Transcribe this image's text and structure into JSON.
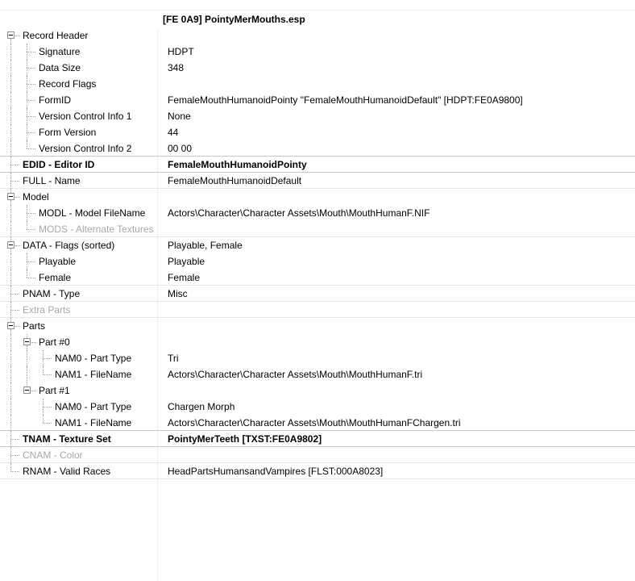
{
  "header": {
    "title": "[FE 0A9] PointyMerMouths.esp"
  },
  "rows": [
    {
      "label": "Record Header",
      "value": ""
    },
    {
      "label": "Signature",
      "value": "HDPT"
    },
    {
      "label": "Data Size",
      "value": "348"
    },
    {
      "label": "Record Flags",
      "value": ""
    },
    {
      "label": "FormID",
      "value": "FemaleMouthHumanoidPointy \"FemaleMouthHumanoidDefault\" [HDPT:FE0A9800]"
    },
    {
      "label": "Version Control Info 1",
      "value": "None"
    },
    {
      "label": "Form Version",
      "value": "44"
    },
    {
      "label": "Version Control Info 2",
      "value": "00 00"
    },
    {
      "label": "EDID - Editor ID",
      "value": "FemaleMouthHumanoidPointy"
    },
    {
      "label": "FULL - Name",
      "value": "FemaleMouthHumanoidDefault"
    },
    {
      "label": "Model",
      "value": ""
    },
    {
      "label": "MODL - Model FileName",
      "value": "Actors\\Character\\Character Assets\\Mouth\\MouthHumanF.NIF"
    },
    {
      "label": "MODS - Alternate Textures",
      "value": ""
    },
    {
      "label": "DATA - Flags (sorted)",
      "value": "Playable, Female"
    },
    {
      "label": "Playable",
      "value": "Playable"
    },
    {
      "label": "Female",
      "value": "Female"
    },
    {
      "label": "PNAM - Type",
      "value": "Misc"
    },
    {
      "label": "Extra Parts",
      "value": ""
    },
    {
      "label": "Parts",
      "value": ""
    },
    {
      "label": "Part #0",
      "value": ""
    },
    {
      "label": "NAM0 - Part Type",
      "value": "Tri"
    },
    {
      "label": "NAM1 - FileName",
      "value": "Actors\\Character\\Character Assets\\Mouth\\MouthHumanF.tri"
    },
    {
      "label": "Part #1",
      "value": ""
    },
    {
      "label": "NAM0 - Part Type",
      "value": "Chargen Morph"
    },
    {
      "label": "NAM1 - FileName",
      "value": "Actors\\Character\\Character Assets\\Mouth\\MouthHumanFChargen.tri"
    },
    {
      "label": "TNAM - Texture Set",
      "value": "PointyMerTeeth [TXST:FE0A9802]"
    },
    {
      "label": "CNAM - Color",
      "value": ""
    },
    {
      "label": "RNAM - Valid Races",
      "value": "HeadPartsHumansandVampires [FLST:000A8023]"
    }
  ]
}
